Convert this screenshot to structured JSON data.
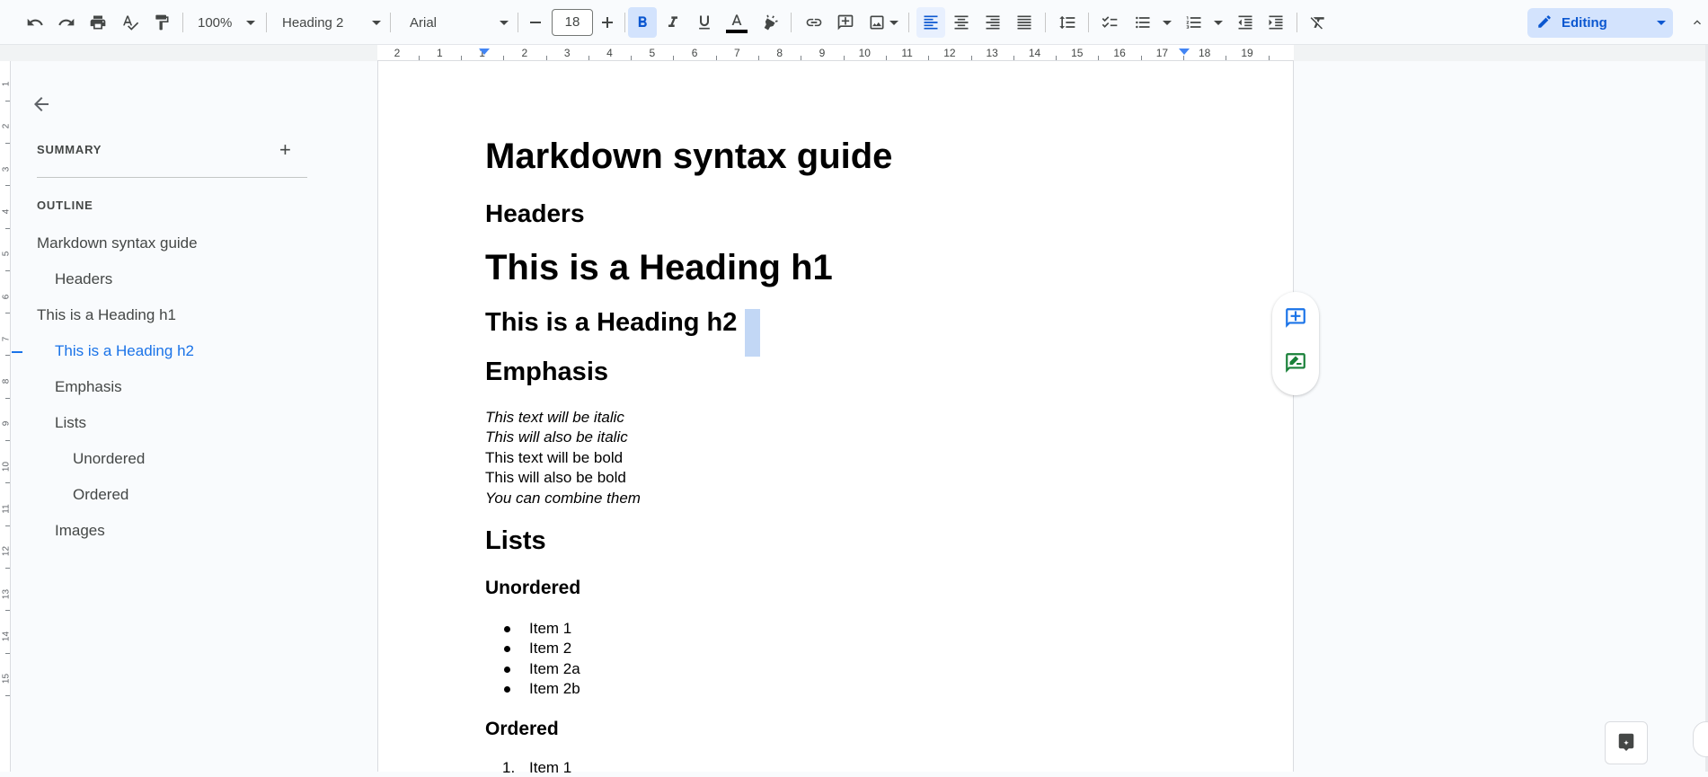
{
  "toolbar": {
    "zoom": "100%",
    "style": "Heading 2",
    "font": "Arial",
    "font_size": "18",
    "mode": "Editing",
    "colors": {
      "accent": "#0b57d0",
      "active_bg": "#d3e3fd"
    }
  },
  "ruler": {
    "labels": [
      "2",
      "1",
      "1",
      "2",
      "3",
      "4",
      "5",
      "6",
      "7",
      "8",
      "9",
      "10",
      "11",
      "12",
      "13",
      "14",
      "15",
      "16",
      "17",
      "18",
      "19"
    ]
  },
  "vruler": {
    "labels": [
      "1",
      "2",
      "3",
      "4",
      "5",
      "6",
      "7",
      "8",
      "9",
      "10",
      "11",
      "12",
      "13",
      "14",
      "15"
    ]
  },
  "outline": {
    "summary_label": "SUMMARY",
    "outline_label": "OUTLINE",
    "items": [
      {
        "label": "Markdown syntax guide"
      },
      {
        "label": "Headers"
      },
      {
        "label": "This is a Heading h1"
      },
      {
        "label": "This is a Heading h2"
      },
      {
        "label": "Emphasis"
      },
      {
        "label": "Lists"
      },
      {
        "label": "Unordered"
      },
      {
        "label": "Ordered"
      },
      {
        "label": "Images"
      }
    ]
  },
  "document": {
    "title": "Markdown syntax guide",
    "headers": "Headers",
    "h1": "This is a Heading h1",
    "h2": "This is a Heading h2",
    "emphasis": "Emphasis",
    "lines": [
      "This text will be italic",
      "This will also be italic",
      "This text will be bold",
      "This will also be bold",
      "You can combine them"
    ],
    "lists": "Lists",
    "unordered": "Unordered",
    "unordered_items": [
      "Item 1",
      "Item 2",
      "Item 2a",
      "Item 2b"
    ],
    "ordered": "Ordered",
    "ordered_items": [
      {
        "num": "1.",
        "label": "Item 1"
      }
    ]
  }
}
